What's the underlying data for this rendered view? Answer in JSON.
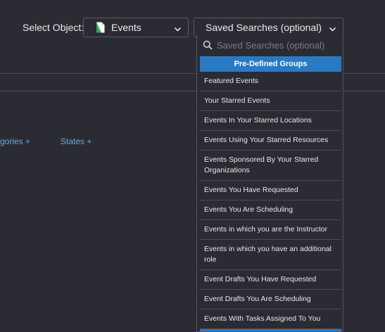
{
  "header": {
    "select_object_label": "Select Object:",
    "object_select": {
      "value": "Events",
      "icon": "document-icon"
    },
    "saved_searches": {
      "value": "Saved Searches (optional)"
    }
  },
  "filters": {
    "categories_link": "gories +",
    "states_link": "States +"
  },
  "dropdown": {
    "search_placeholder": "Saved Searches (optional)",
    "group_header": "Pre-Defined Groups",
    "items": [
      {
        "label": "Featured Events"
      },
      {
        "label": "Your Starred Events"
      },
      {
        "label": "Events In Your Starred Locations"
      },
      {
        "label": "Events Using Your Starred Resources"
      },
      {
        "label": "Events Sponsored By Your Starred Organizations"
      },
      {
        "label": "Events You Have Requested"
      },
      {
        "label": "Events You Are Scheduling"
      },
      {
        "label": "Events in which you are the Instructor"
      },
      {
        "label": "Events in which you have an additional role"
      },
      {
        "label": "Event Drafts You Have Requested"
      },
      {
        "label": "Event Drafts You Are Scheduling"
      },
      {
        "label": "Events With Tasks Assigned To You"
      }
    ]
  },
  "colors": {
    "background": "#2b2b33",
    "accent": "#2a7ac3",
    "link": "#6ea8e0"
  }
}
